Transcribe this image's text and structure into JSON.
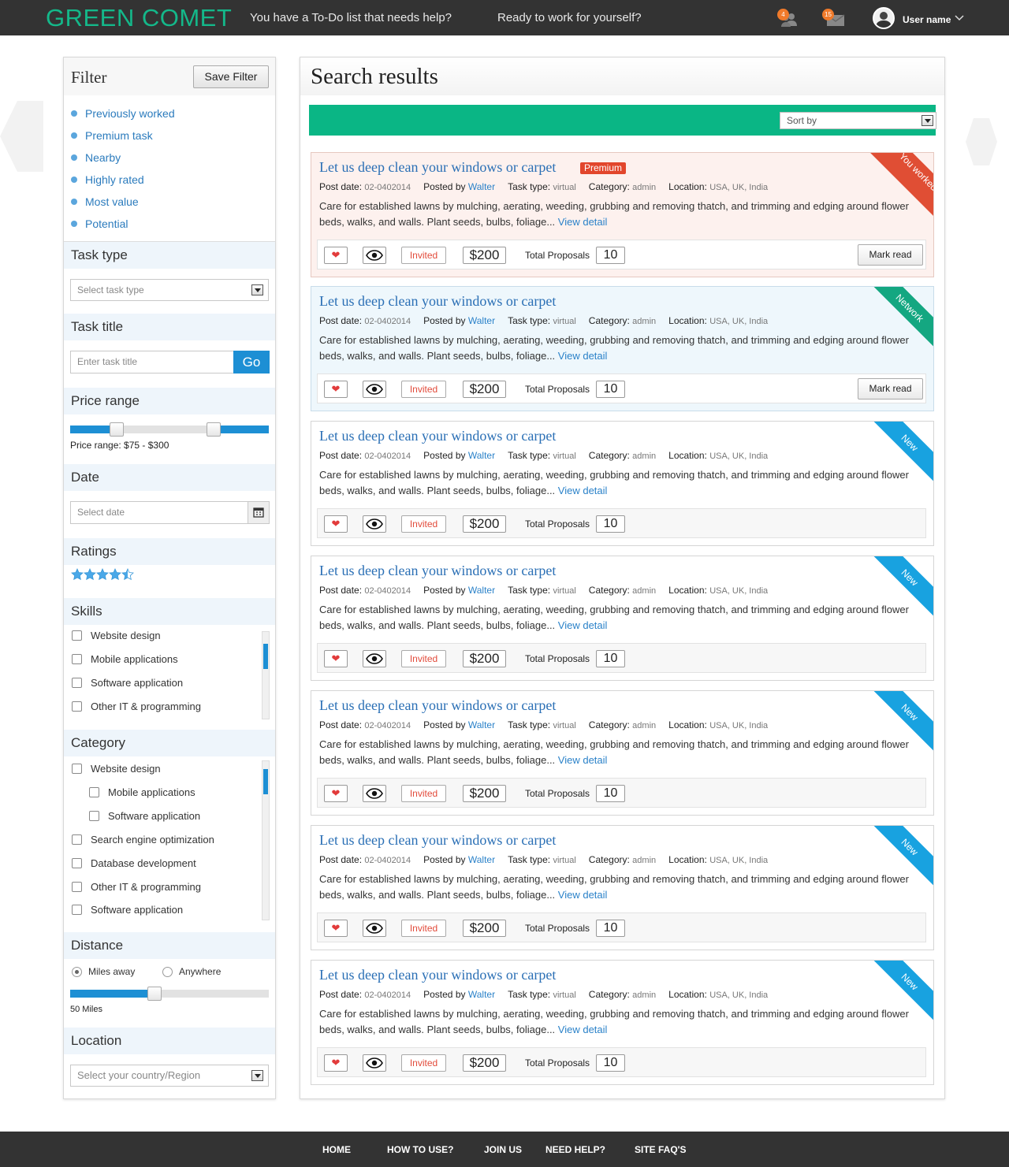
{
  "header": {
    "logo": "GREEN COMET",
    "links": [
      "You have a To-Do list that needs help?",
      "Ready to work for yourself?"
    ],
    "notifications": {
      "users_count": "4",
      "messages_count": "15"
    },
    "user_name": "User name"
  },
  "filter": {
    "title": "Filter",
    "save_label": "Save Filter",
    "quick_filters": [
      "Previously worked",
      "Premium task",
      "Nearby",
      "Highly rated",
      "Most value",
      "Potential"
    ],
    "task_type": {
      "heading": "Task type",
      "placeholder": "Select task type"
    },
    "task_title": {
      "heading": "Task title",
      "placeholder": "Enter task title",
      "go_label": "Go"
    },
    "price_range": {
      "heading": "Price range",
      "label": "Price range: $75 - $300",
      "min": 75,
      "max": 300
    },
    "date": {
      "heading": "Date",
      "placeholder": "Select date"
    },
    "ratings": {
      "heading": "Ratings",
      "value": 4.5,
      "max": 5
    },
    "skills": {
      "heading": "Skills",
      "items": [
        "Website design",
        "Mobile applications",
        "Software application",
        "Other IT & programming"
      ]
    },
    "category": {
      "heading": "Category",
      "items": [
        {
          "label": "Website design",
          "indent": false
        },
        {
          "label": "Mobile applications",
          "indent": true
        },
        {
          "label": "Software application",
          "indent": true
        },
        {
          "label": "Search engine optimization",
          "indent": false
        },
        {
          "label": "Database development",
          "indent": false
        },
        {
          "label": "Other IT & programming",
          "indent": false
        },
        {
          "label": "Software application",
          "indent": false
        }
      ]
    },
    "distance": {
      "heading": "Distance",
      "option_miles": "Miles away",
      "option_anywhere": "Anywhere",
      "selected": "Miles away",
      "label": "50 Miles"
    },
    "location": {
      "heading": "Location",
      "placeholder": "Select your country/Region"
    }
  },
  "results": {
    "title": "Search results",
    "sort_placeholder": "Sort by",
    "labels": {
      "post_date": "Post date:",
      "posted_by": "Posted by",
      "task_type": "Task type:",
      "category": "Category:",
      "location": "Location:",
      "view_detail": "View detail",
      "invited": "Invited",
      "total_proposals": "Total Proposals",
      "mark_read": "Mark read",
      "premium": "Premium"
    },
    "cards": [
      {
        "title": "Let us deep clean your windows or carpet",
        "premium": true,
        "variant": "premium",
        "ribbon": "You worked",
        "post_date": "02-0402014",
        "posted_by": "Walter",
        "task_type": "virtual",
        "category": "admin",
        "location": "USA, UK, India",
        "description": "Care for established lawns by mulching, aerating, weeding, grubbing and removing thatch, and  trimming and edging around flower beds, walks, and walls. Plant seeds, bulbs, foliage...",
        "price": "$200",
        "proposals": "10",
        "mark_read": true
      },
      {
        "title": "Let us deep clean your windows or carpet",
        "premium": false,
        "variant": "network",
        "ribbon": "Network",
        "post_date": "02-0402014",
        "posted_by": "Walter",
        "task_type": "virtual",
        "category": "admin",
        "location": "USA, UK, India",
        "description": "Care for established lawns by mulching, aerating, weeding, grubbing and removing thatch, and  trimming and edging around flower beds, walks, and walls. Plant seeds, bulbs, foliage...",
        "price": "$200",
        "proposals": "10",
        "mark_read": true
      },
      {
        "title": "Let us deep clean your windows or carpet",
        "premium": false,
        "variant": "new",
        "ribbon": "New",
        "post_date": "02-0402014",
        "posted_by": "Walter",
        "task_type": "virtual",
        "category": "admin",
        "location": "USA, UK, India",
        "description": "Care for established lawns by mulching, aerating, weeding, grubbing and removing thatch, and  trimming and edging around flower beds, walks, and walls. Plant seeds, bulbs, foliage...",
        "price": "$200",
        "proposals": "10",
        "mark_read": false
      },
      {
        "title": "Let us deep clean your windows or carpet",
        "premium": false,
        "variant": "new",
        "ribbon": "New",
        "post_date": "02-0402014",
        "posted_by": "Walter",
        "task_type": "virtual",
        "category": "admin",
        "location": "USA, UK, India",
        "description": "Care for established lawns by mulching, aerating, weeding, grubbing and removing thatch, and  trimming and edging around flower beds, walks, and walls. Plant seeds, bulbs, foliage...",
        "price": "$200",
        "proposals": "10",
        "mark_read": false
      },
      {
        "title": "Let us deep clean your windows or carpet",
        "premium": false,
        "variant": "new",
        "ribbon": "New",
        "post_date": "02-0402014",
        "posted_by": "Walter",
        "task_type": "virtual",
        "category": "admin",
        "location": "USA, UK, India",
        "description": "Care for established lawns by mulching, aerating, weeding, grubbing and removing thatch, and  trimming and edging around flower beds, walks, and walls. Plant seeds, bulbs, foliage...",
        "price": "$200",
        "proposals": "10",
        "mark_read": false
      },
      {
        "title": "Let us deep clean your windows or carpet",
        "premium": false,
        "variant": "new",
        "ribbon": "New",
        "post_date": "02-0402014",
        "posted_by": "Walter",
        "task_type": "virtual",
        "category": "admin",
        "location": "USA, UK, India",
        "description": "Care for established lawns by mulching, aerating, weeding, grubbing and removing thatch, and  trimming and edging around flower beds, walks, and walls. Plant seeds, bulbs, foliage...",
        "price": "$200",
        "proposals": "10",
        "mark_read": false
      },
      {
        "title": "Let us deep clean your windows or carpet",
        "premium": false,
        "variant": "new",
        "ribbon": "New",
        "post_date": "02-0402014",
        "posted_by": "Walter",
        "task_type": "virtual",
        "category": "admin",
        "location": "USA, UK, India",
        "description": "Care for established lawns by mulching, aerating, weeding, grubbing and removing thatch, and  trimming and edging around flower beds, walks, and walls. Plant seeds, bulbs, foliage...",
        "price": "$200",
        "proposals": "10",
        "mark_read": false
      }
    ]
  },
  "footer": {
    "links": [
      "HOME",
      "HOW TO USE?",
      "JOIN US",
      "NEED HELP?",
      "SITE FAQ'S"
    ]
  },
  "colors": {
    "brand_green": "#14b88a",
    "bar_green": "#0ab685",
    "accent_blue": "#1d8fd4",
    "link_blue": "#2a6fb5",
    "premium_red": "#e2462c",
    "new_ribbon": "#18a2e0",
    "network_ribbon": "#14a781"
  },
  "icons": [
    "users-icon",
    "messages-icon",
    "chevron-down-icon",
    "calendar-icon",
    "star-icon",
    "heart-icon",
    "eye-icon"
  ]
}
